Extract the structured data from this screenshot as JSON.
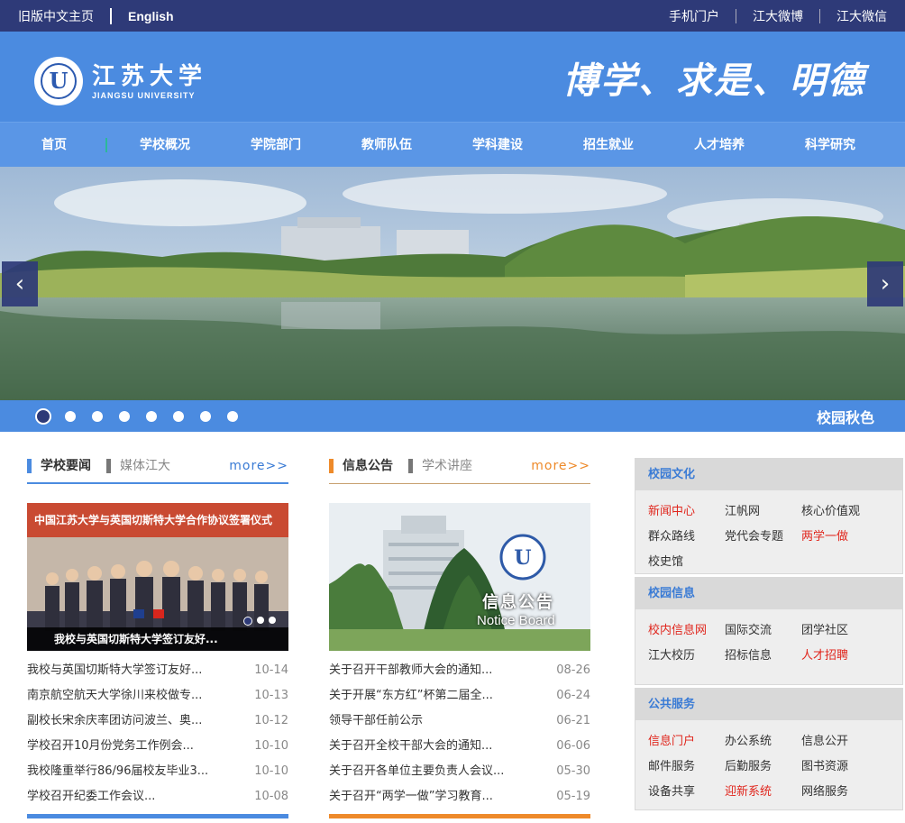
{
  "topbar": {
    "left": [
      "旧版中文主页",
      "English"
    ],
    "right": [
      "手机门户",
      "江大微博",
      "江大微信"
    ]
  },
  "header": {
    "logo_cn": "江苏大学",
    "logo_en": "JIANGSU UNIVERSITY",
    "motto": "博学、求是、明德"
  },
  "nav": [
    "首页",
    "学校概况",
    "学院部门",
    "教师队伍",
    "学科建设",
    "招生就业",
    "人才培养",
    "科学研究"
  ],
  "slider": {
    "caption": "校园秋色",
    "dot_count": 8,
    "active_dot": 0,
    "prev": "‹",
    "next": "›"
  },
  "news": {
    "tab_active": "学校要闻",
    "tab_other": "媒体江大",
    "more": "more>>",
    "pic_caption": "我校与英国切斯特大学签订友好...",
    "pic_banner": "中国江苏大学与英国切斯特大学合作协议签署仪式",
    "items": [
      {
        "title": "我校与英国切斯特大学签订友好...",
        "date": "10-14"
      },
      {
        "title": "南京航空航天大学徐川来校做专...",
        "date": "10-13"
      },
      {
        "title": "副校长宋余庆率团访问波兰、奥...",
        "date": "10-12"
      },
      {
        "title": "学校召开10月份党务工作例会...",
        "date": "10-10"
      },
      {
        "title": "我校隆重举行86/96届校友毕业3...",
        "date": "10-10"
      },
      {
        "title": "学校召开纪委工作会议...",
        "date": "10-08"
      }
    ]
  },
  "notice": {
    "tab_active": "信息公告",
    "tab_other": "学术讲座",
    "more": "more>>",
    "pic_title": "信息公告",
    "pic_subtitle": "Notice Board",
    "items": [
      {
        "title": "关于召开干部教师大会的通知...",
        "date": "08-26"
      },
      {
        "title": "关于开展“东方红”杯第二届全...",
        "date": "06-24"
      },
      {
        "title": "领导干部任前公示",
        "date": "06-21"
      },
      {
        "title": "关于召开全校干部大会的通知...",
        "date": "06-06"
      },
      {
        "title": "关于召开各单位主要负责人会议...",
        "date": "05-30"
      },
      {
        "title": "关于召开“两学一做”学习教育...",
        "date": "05-19"
      }
    ]
  },
  "sidebar": [
    {
      "title": "校园文化",
      "links": [
        {
          "label": "新闻中心",
          "red": true
        },
        {
          "label": "江帆网",
          "red": false
        },
        {
          "label": "核心价值观",
          "red": false
        },
        {
          "label": "群众路线",
          "red": false
        },
        {
          "label": "党代会专题",
          "red": false
        },
        {
          "label": "两学一做",
          "red": true
        },
        {
          "label": "校史馆",
          "red": false
        }
      ]
    },
    {
      "title": "校园信息",
      "links": [
        {
          "label": "校内信息网",
          "red": true
        },
        {
          "label": "国际交流",
          "red": false
        },
        {
          "label": "团学社区",
          "red": false
        },
        {
          "label": "江大校历",
          "red": false
        },
        {
          "label": "招标信息",
          "red": false
        },
        {
          "label": "人才招聘",
          "red": true
        }
      ]
    },
    {
      "title": "公共服务",
      "links": [
        {
          "label": "信息门户",
          "red": true
        },
        {
          "label": "办公系统",
          "red": false
        },
        {
          "label": "信息公开",
          "red": false
        },
        {
          "label": "邮件服务",
          "red": false
        },
        {
          "label": "后勤服务",
          "red": false
        },
        {
          "label": "图书资源",
          "red": false
        },
        {
          "label": "设备共享",
          "red": false
        },
        {
          "label": "迎新系统",
          "red": true
        },
        {
          "label": "网络服务",
          "red": false
        }
      ]
    }
  ]
}
